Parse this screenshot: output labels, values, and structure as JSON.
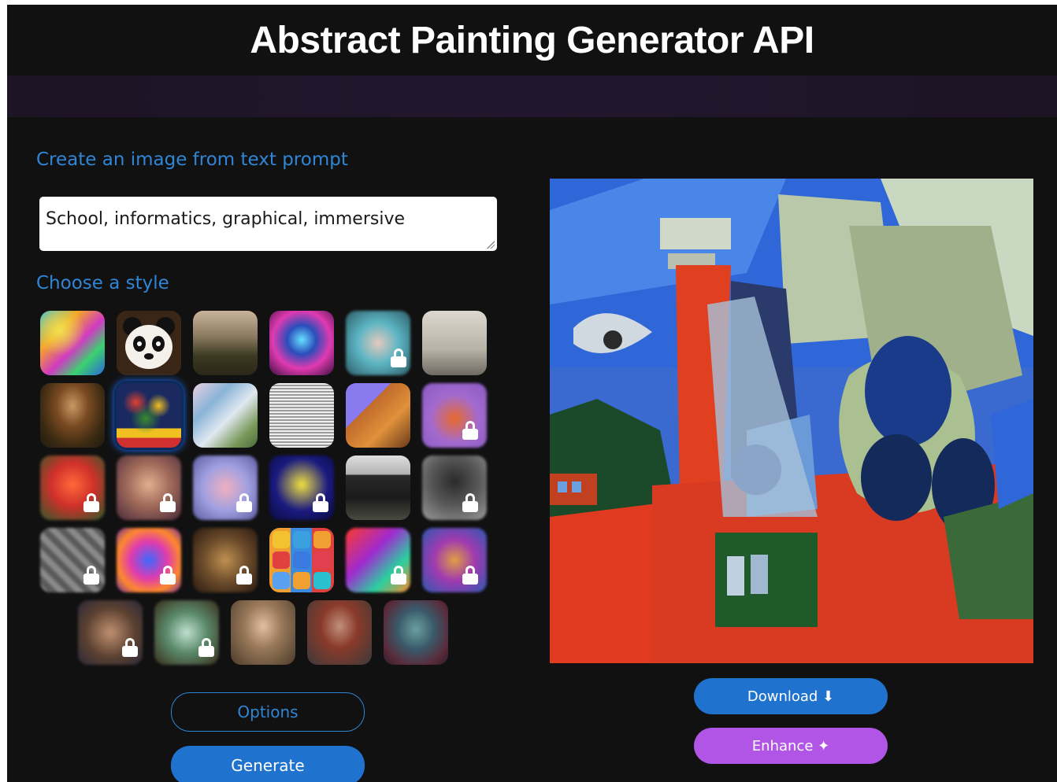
{
  "header": {
    "title": "Abstract Painting Generator API"
  },
  "prompt_section": {
    "label": "Create an image from text prompt",
    "value": "School, informatics, graphical, immersive"
  },
  "style_section": {
    "label": "Choose a style",
    "styles": [
      {
        "name": "style-rainbow-paint",
        "locked": false
      },
      {
        "name": "style-panda",
        "locked": false
      },
      {
        "name": "style-landscape",
        "locked": false
      },
      {
        "name": "style-neon-robot",
        "locked": false
      },
      {
        "name": "style-anime-girl",
        "locked": true
      },
      {
        "name": "style-vintage-engraving",
        "locked": false
      },
      {
        "name": "style-mona-lisa",
        "locked": false
      },
      {
        "name": "style-flowers",
        "locked": false,
        "selected": true
      },
      {
        "name": "style-ballet",
        "locked": false
      },
      {
        "name": "style-etching-cup",
        "locked": false
      },
      {
        "name": "style-isometric",
        "locked": false
      },
      {
        "name": "style-fox",
        "locked": true
      },
      {
        "name": "style-red-portrait",
        "locked": true
      },
      {
        "name": "style-woman-portrait",
        "locked": true
      },
      {
        "name": "style-pastel-cloud",
        "locked": true
      },
      {
        "name": "style-pop-art-marilyn",
        "locked": true
      },
      {
        "name": "style-architecture",
        "locked": false
      },
      {
        "name": "style-gray-object",
        "locked": true
      },
      {
        "name": "style-gray-mosaic",
        "locked": true
      },
      {
        "name": "style-rabbit-neon",
        "locked": true
      },
      {
        "name": "style-brown-abstract",
        "locked": true
      },
      {
        "name": "style-icon-grid",
        "locked": false
      },
      {
        "name": "style-red-swirl",
        "locked": true
      },
      {
        "name": "style-colorful-face",
        "locked": true
      },
      {
        "name": "style-horned-creature",
        "locked": true
      },
      {
        "name": "style-green-abstract",
        "locked": true
      },
      {
        "name": "style-woman-painting",
        "locked": false
      },
      {
        "name": "style-steampunk-man",
        "locked": false
      },
      {
        "name": "style-green-face",
        "locked": false
      }
    ]
  },
  "buttons": {
    "options": "Options",
    "generate": "Generate",
    "download": "Download ⬇",
    "enhance": "Enhance ✦"
  },
  "colors": {
    "background": "#111111",
    "accent_blue": "#2f86d6",
    "button_blue": "#1f73cf",
    "enhance_purple": "#b155e6"
  }
}
